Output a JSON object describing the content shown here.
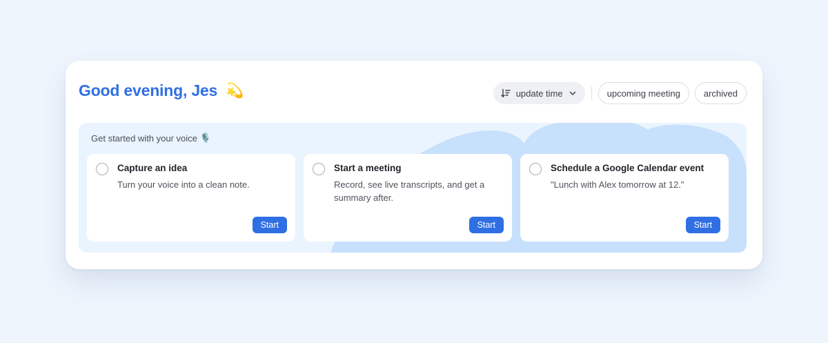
{
  "header": {
    "greeting": "Good evening, Jes",
    "greeting_emoji": "💫"
  },
  "toolbar": {
    "sort_label": "update time",
    "filters": [
      "upcoming meeting",
      "archived"
    ]
  },
  "getting_started": {
    "title": "Get started with your voice",
    "title_icon": "🎙️",
    "tasks": [
      {
        "title": "Capture an idea",
        "description": "Turn your voice into a clean note.",
        "button": "Start"
      },
      {
        "title": "Start a meeting",
        "description": "Record, see live transcripts, and get a summary after.",
        "button": "Start"
      },
      {
        "title": "Schedule a Google Calendar event",
        "description": "\"Lunch with Alex tomorrow at 12.\"",
        "button": "Start"
      }
    ]
  },
  "colors": {
    "accent": "#2f6fe3",
    "page_background": "#eef5fd",
    "panel_background": "#eaf4fe",
    "blob": "#c7e0fb"
  }
}
